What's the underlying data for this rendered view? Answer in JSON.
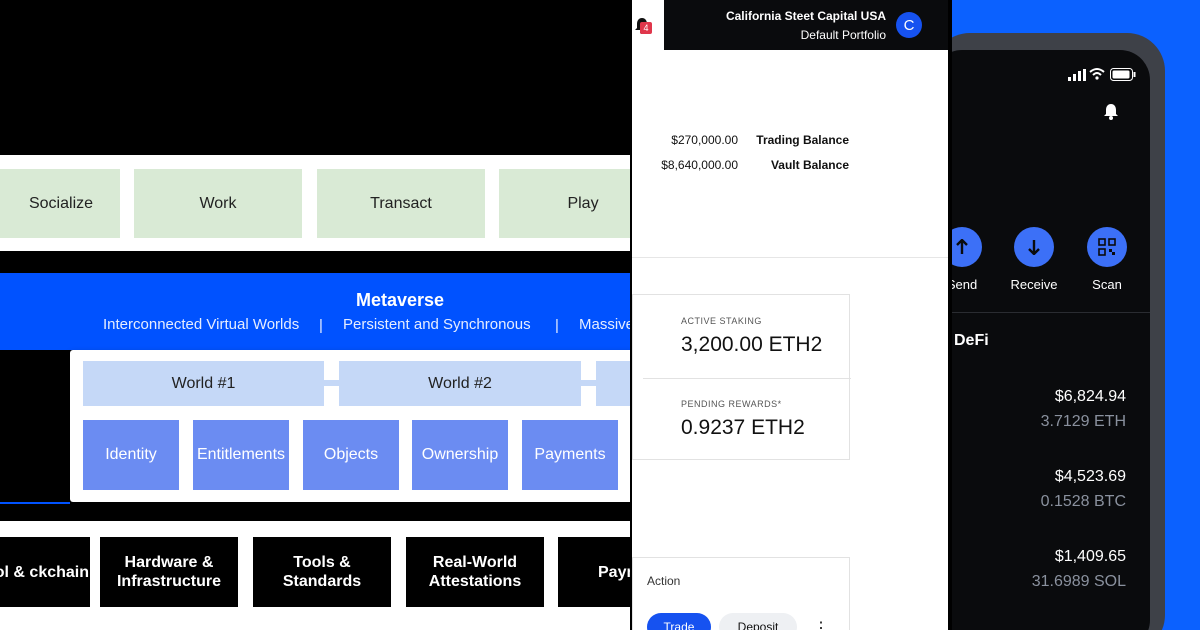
{
  "diagram": {
    "activities": [
      "Socialize",
      "Work",
      "Transact",
      "Play"
    ],
    "metaverse": {
      "title": "Metaverse",
      "attributes": [
        "Interconnected Virtual Worlds",
        "Persistent and Synchronous",
        "Massive"
      ]
    },
    "worlds": [
      "World #1",
      "World #2"
    ],
    "layers": [
      "Identity",
      "Entitlements",
      "Objects",
      "Ownership",
      "Payments"
    ],
    "foundation": [
      "otocol & ckchain",
      "Hardware & Infrastructure",
      "Tools & Standards",
      "Real-World Attestations",
      "Paym Ra"
    ]
  },
  "dashboard": {
    "notification_count": "4",
    "org_name": "California Steet Capital USA",
    "portfolio": "Default Portfolio",
    "avatar_initial": "C",
    "balances": [
      {
        "amount": "$270,000.00",
        "label": "Trading Balance"
      },
      {
        "amount": "$8,640,000.00",
        "label": "Vault Balance"
      }
    ],
    "staking": [
      {
        "label": "ACTIVE STAKING",
        "value": "3,200.00 ETH2"
      },
      {
        "label": "PENDING REWARDS*",
        "value": "0.9237 ETH2"
      }
    ],
    "action": {
      "label": "Action",
      "trade": "Trade",
      "deposit": "Deposit",
      "more": "⋮"
    }
  },
  "wallet": {
    "actions": [
      {
        "label": "Send",
        "icon": "arrow-up-icon"
      },
      {
        "label": "Receive",
        "icon": "arrow-down-icon"
      },
      {
        "label": "Scan",
        "icon": "qr-code-icon"
      }
    ],
    "section": "DeFi",
    "assets": [
      {
        "usd": "$6,824.94",
        "amount": "3.7129 ETH"
      },
      {
        "usd": "$4,523.69",
        "amount": "0.1528 BTC"
      },
      {
        "usd": "$1,409.65",
        "amount": "31.6989 SOL"
      }
    ]
  },
  "colors": {
    "brand_blue": "#0052ff",
    "activity_green": "#d9ead5",
    "world_blue": "#c5d8f7",
    "layer_blue": "#6b8cf2"
  }
}
